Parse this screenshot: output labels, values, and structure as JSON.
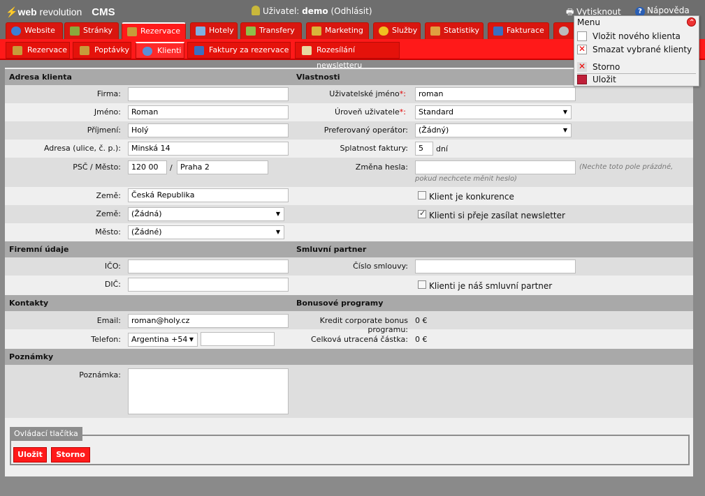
{
  "header": {
    "logo_web": "web",
    "logo_revolution": " revolution",
    "logo_cms": "CMS",
    "user_label": "Uživatel:",
    "user_name": "demo",
    "logout_label": "(Odhlásit)",
    "print_label": "Vytisknout",
    "help_label": "Nápověda"
  },
  "main_tabs": [
    {
      "label": "Website",
      "icon": "globe-icon",
      "color": "#3b7fd4"
    },
    {
      "label": "Stránky",
      "icon": "pages-icon",
      "color": "#8aa83c"
    },
    {
      "label": "Rezervace",
      "icon": "calendar-icon",
      "color": "#c79b3a"
    },
    {
      "label": "Hotely",
      "icon": "hotel-icon",
      "color": "#7fb0e0"
    },
    {
      "label": "Transfery",
      "icon": "car-icon",
      "color": "#8fbf4a"
    },
    {
      "label": "Marketing",
      "icon": "trophy-icon",
      "color": "#d9b43a"
    },
    {
      "label": "Služby",
      "icon": "star-icon",
      "color": "#f0c020"
    },
    {
      "label": "Statistiky",
      "icon": "chart-icon",
      "color": "#e0a040"
    },
    {
      "label": "Fakturace",
      "icon": "invoice-icon",
      "color": "#3a6fc0"
    },
    {
      "label": "",
      "icon": "gear-icon",
      "color": "#bbbbbb"
    }
  ],
  "sub_tabs": [
    {
      "label": "Rezervace",
      "icon": "calendar-icon",
      "color": "#c79b3a"
    },
    {
      "label": "Poptávky",
      "icon": "inquiry-icon",
      "color": "#c79b3a"
    },
    {
      "label": "Klienti",
      "icon": "users-icon",
      "color": "#5a8fd6"
    },
    {
      "label": "Faktury za rezervace",
      "icon": "invoice-icon",
      "color": "#3a6fc0"
    },
    {
      "label": "Rozesílání newsletteru",
      "icon": "newsletter-icon",
      "color": "#e8d8a0"
    }
  ],
  "sections": {
    "address": "Adresa klienta",
    "properties": "Vlastnosti",
    "company": "Firemní údaje",
    "partner": "Smluvní partner",
    "contacts": "Kontakty",
    "bonus": "Bonusové programy",
    "notes": "Poznámky"
  },
  "address": {
    "firma_label": "Firma:",
    "firma_value": "",
    "jmeno_label": "Jméno:",
    "jmeno_value": "Roman",
    "prijmeni_label": "Příjmení:",
    "prijmeni_value": "Holý",
    "adresa_label": "Adresa (ulice, č. p.):",
    "adresa_value": "Minská 14",
    "psc_label": "PSČ / Město:",
    "psc_value": "120 00",
    "psc_sep": "/",
    "mesto_value": "Praha 2",
    "zeme_text_label": "Země:",
    "zeme_text_value": "Česká Republika",
    "zeme_select_label": "Země:",
    "zeme_select_value": "(Žádná)",
    "mesto_select_label": "Město:",
    "mesto_select_value": "(Žádné)"
  },
  "properties": {
    "username_label": "Uživatelské jméno",
    "username_value": "roman",
    "level_label": "Úroveň uživatele",
    "level_value": "Standard",
    "operator_label": "Preferovaný operátor:",
    "operator_value": "(Žádný)",
    "due_label": "Splatnost faktury:",
    "due_value": "5",
    "due_unit": "dní",
    "pwd_label": "Změna hesla:",
    "pwd_value": "",
    "pwd_note1": "(Nechte toto pole prázdné,",
    "pwd_note2": "pokud nechcete měnit heslo)",
    "competitor_label": "Klient je konkurence",
    "competitor_checked": false,
    "newsletter_label": "Klienti si přeje zasílat newsletter",
    "newsletter_checked": true,
    "required_mark": "*:"
  },
  "company": {
    "ico_label": "IČO:",
    "ico_value": "",
    "dic_label": "DIČ:",
    "dic_value": ""
  },
  "partner": {
    "contract_label": "Číslo smlouvy:",
    "contract_value": "",
    "is_partner_label": "Klienti je náš smluvní partner",
    "is_partner_checked": false
  },
  "contacts": {
    "email_label": "Email:",
    "email_value": "roman@holy.cz",
    "phone_label": "Telefon:",
    "phone_country": "Argentina +54",
    "phone_value": ""
  },
  "bonus": {
    "credit_label": "Kredit corporate bonus programu:",
    "credit_value": "0 €",
    "spent_label": "Celková utracená částka:",
    "spent_value": "0 €"
  },
  "notes": {
    "note_label": "Poznámka:",
    "note_value": ""
  },
  "controls": {
    "legend": "Ovládací tlačítka",
    "save_label": "Uložit",
    "cancel_label": "Storno"
  },
  "menu": {
    "title": "Menu",
    "items": [
      {
        "label": "Vložit nového klienta",
        "icon": "new-document-icon"
      },
      {
        "label": "Smazat vybrané klienty",
        "icon": "delete-icon"
      },
      {
        "label": "Storno",
        "icon": "cancel-icon"
      },
      {
        "label": "Uložit",
        "icon": "save-icon"
      }
    ]
  },
  "colors": {
    "accent_red": "#ff1919",
    "required_red": "#e00000"
  }
}
